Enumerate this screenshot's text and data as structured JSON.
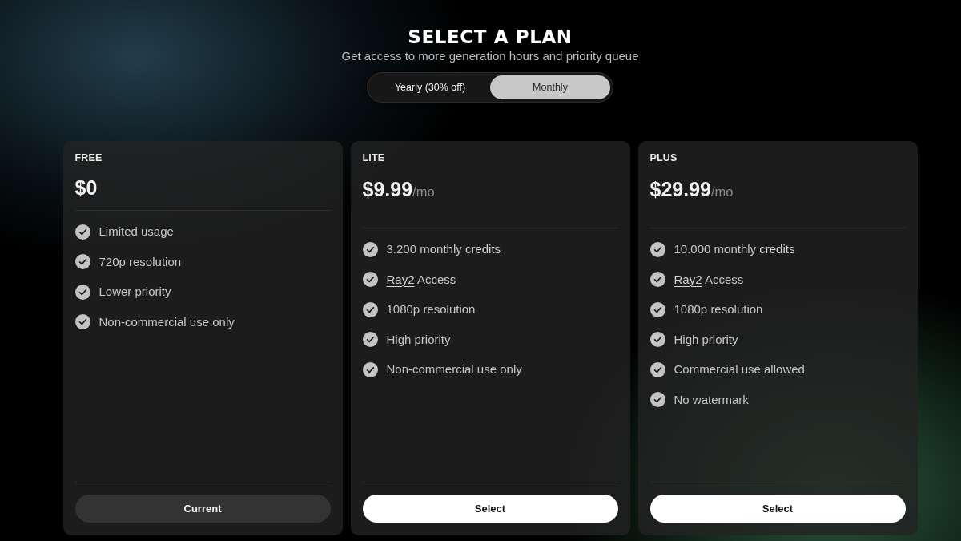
{
  "header": {
    "title": "SELECT A PLAN",
    "subtitle": "Get access to more generation hours and priority queue"
  },
  "billing_toggle": [
    {
      "label": "Yearly (30% off)",
      "selected": false
    },
    {
      "label": "Monthly",
      "selected": true
    }
  ],
  "plans": [
    {
      "name": "FREE",
      "price": "$0",
      "features": [
        {
          "segments": [
            {
              "kind": "text",
              "text": "Limited usage"
            }
          ]
        },
        {
          "segments": [
            {
              "kind": "text",
              "text": "720p resolution"
            }
          ]
        },
        {
          "segments": [
            {
              "kind": "text",
              "text": "Lower priority"
            }
          ]
        },
        {
          "segments": [
            {
              "kind": "text",
              "text": "Non-commercial use only"
            }
          ]
        }
      ],
      "button": {
        "label": "Current",
        "kind": "current"
      }
    },
    {
      "name": "LITE",
      "price": "$9.99",
      "period": "/mo",
      "features": [
        {
          "segments": [
            {
              "kind": "text",
              "text": "3.200 monthly"
            },
            {
              "kind": "link",
              "text": "credits"
            }
          ]
        },
        {
          "segments": [
            {
              "kind": "link",
              "text": "Ray2"
            },
            {
              "kind": "text",
              "text": "Access"
            }
          ]
        },
        {
          "segments": [
            {
              "kind": "text",
              "text": "1080p resolution"
            }
          ]
        },
        {
          "segments": [
            {
              "kind": "text",
              "text": "High priority"
            }
          ]
        },
        {
          "segments": [
            {
              "kind": "text",
              "text": "Non-commercial use only"
            }
          ]
        }
      ],
      "button": {
        "label": "Select",
        "kind": "select"
      }
    },
    {
      "name": "PLUS",
      "price": "$29.99",
      "period": "/mo",
      "features": [
        {
          "segments": [
            {
              "kind": "text",
              "text": "10.000 monthly"
            },
            {
              "kind": "link",
              "text": "credits"
            }
          ]
        },
        {
          "segments": [
            {
              "kind": "link",
              "text": "Ray2"
            },
            {
              "kind": "text",
              "text": "Access"
            }
          ]
        },
        {
          "segments": [
            {
              "kind": "text",
              "text": "1080p resolution"
            }
          ]
        },
        {
          "segments": [
            {
              "kind": "text",
              "text": "High priority"
            }
          ]
        },
        {
          "segments": [
            {
              "kind": "text",
              "text": "Commercial use allowed"
            }
          ]
        },
        {
          "segments": [
            {
              "kind": "text",
              "text": "No watermark"
            }
          ]
        }
      ],
      "button": {
        "label": "Select",
        "kind": "select"
      }
    }
  ]
}
